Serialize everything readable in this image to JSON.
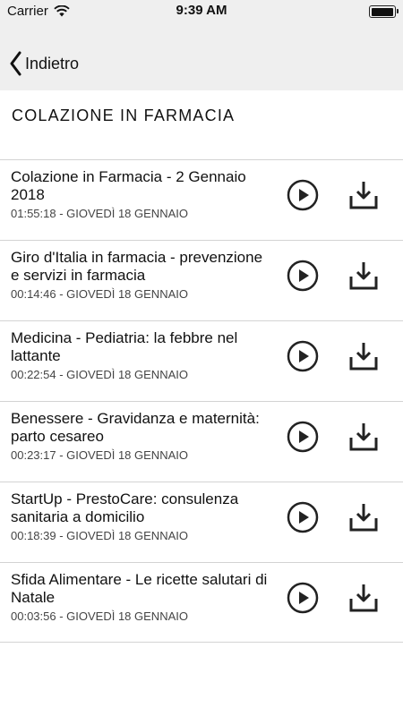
{
  "status_bar": {
    "carrier": "Carrier",
    "time": "9:39 AM"
  },
  "nav": {
    "back_label": "Indietro"
  },
  "page": {
    "title": "COLAZIONE IN FARMACIA"
  },
  "episodes": [
    {
      "title": "Colazione in Farmacia - 2 Gennaio 2018",
      "meta": "01:55:18 - GIOVEDÌ 18 GENNAIO"
    },
    {
      "title": "Giro d'Italia in farmacia - prevenzione e servizi in farmacia",
      "meta": "00:14:46 - GIOVEDÌ 18 GENNAIO"
    },
    {
      "title": "Medicina - Pediatria: la febbre nel lattante",
      "meta": "00:22:54 - GIOVEDÌ 18 GENNAIO"
    },
    {
      "title": "Benessere - Gravidanza e maternità: parto cesareo",
      "meta": "00:23:17 - GIOVEDÌ 18 GENNAIO"
    },
    {
      "title": "StartUp - PrestoCare: consulenza sanitaria a domicilio",
      "meta": "00:18:39 - GIOVEDÌ 18 GENNAIO"
    },
    {
      "title": "Sfida Alimentare - Le ricette salutari di Natale",
      "meta": "00:03:56 - GIOVEDÌ 18 GENNAIO"
    }
  ],
  "icons": {
    "wifi": "wifi-icon",
    "battery": "battery-icon",
    "back": "chevron-left-icon",
    "play": "play-circle-icon",
    "download": "download-icon"
  },
  "colors": {
    "bar_background": "#efefef",
    "text": "#111111",
    "meta_text": "#444444",
    "divider": "#d3d3d3"
  }
}
